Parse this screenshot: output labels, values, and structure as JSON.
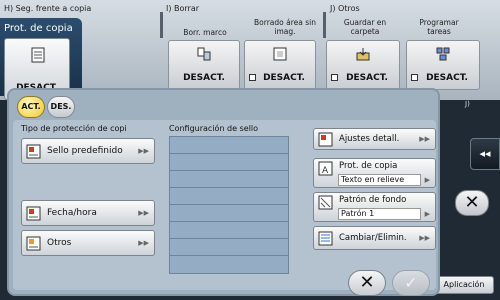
{
  "header": {
    "sections": [
      {
        "label": "H)  Seg. frente a copia"
      },
      {
        "label": "I)    Borrar"
      },
      {
        "label": "J)  Otros"
      }
    ],
    "prot_tab": {
      "title": "Prot. de copia",
      "button": "DESACT."
    },
    "buttons": [
      {
        "title": "Borr. marco",
        "value": "DESACT."
      },
      {
        "title": "Borrado área sin imag.",
        "value": "DESACT."
      },
      {
        "title": "Guardar en carpeta",
        "value": "DESACT."
      },
      {
        "title": "Programar tareas",
        "value": "DESACT."
      }
    ],
    "side_label": "J)"
  },
  "popup": {
    "toggle": {
      "on": "ACT.",
      "off": "DES."
    },
    "left_title": "Tipo de protección de copi",
    "options": [
      {
        "label": "Sello predefinido"
      },
      {
        "label": "Fecha/hora"
      },
      {
        "label": "Otros"
      }
    ],
    "mid_title": "Configuración de sello",
    "right": {
      "settings": "Ajustes detall.",
      "prot": {
        "label": "Prot. de copia",
        "value": "Texto en relieve"
      },
      "pattern": {
        "label": "Patrón de fondo",
        "value": "Patrón 1"
      },
      "change": "Cambiar/Elimin."
    }
  },
  "footer": {
    "close": "✕",
    "ok": "✓",
    "app": "Aplicación"
  },
  "side_arrow": "◂◂"
}
